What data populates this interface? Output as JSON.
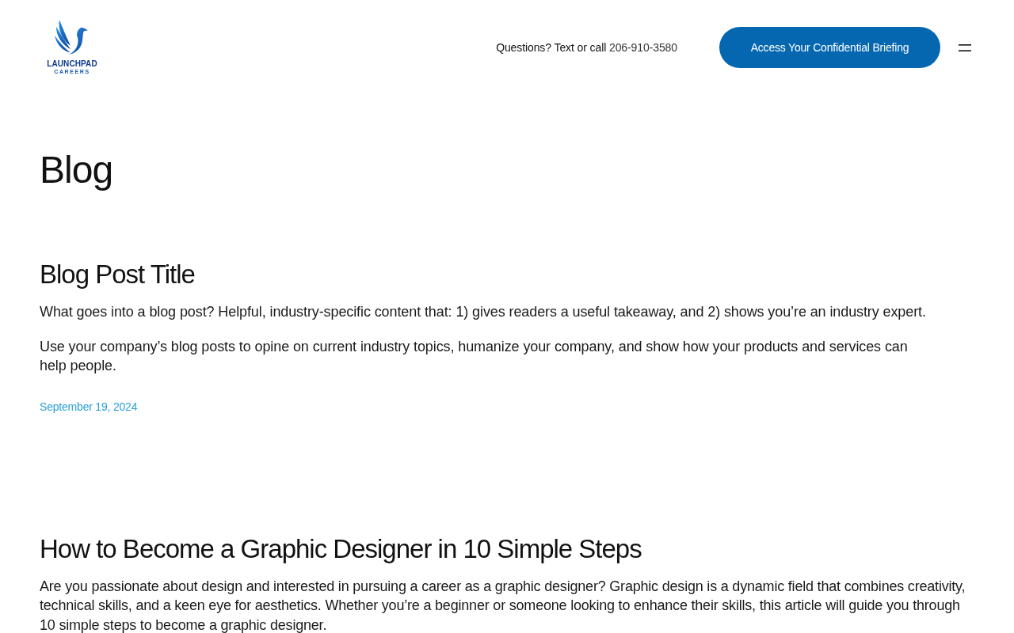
{
  "header": {
    "logo": {
      "name": "LAUNCHPAD",
      "tagline": "CAREERS"
    },
    "contact": {
      "label": "Questions? Text or call",
      "phone": "206-910-3580"
    },
    "cta_button": "Access Your Confidential Briefing"
  },
  "page_title": "Blog",
  "posts": [
    {
      "title": "Blog Post Title",
      "paragraphs": [
        "What goes into a blog post? Helpful, industry-specific content that: 1) gives readers a useful takeaway, and 2) shows you’re an industry expert.",
        "Use your company’s blog posts to opine on current industry topics, humanize your company, and show how your products and services can help people."
      ],
      "date": "September 19, 2024"
    },
    {
      "title": "How to Become a Graphic Designer in 10 Simple Steps",
      "paragraphs": [
        "Are you passionate about design and interested in pursuing a career as a graphic designer? Graphic design is a dynamic field that combines creativity, technical skills, and a keen eye for aesthetics. Whether you’re a beginner or someone looking to enhance their skills, this article will guide you through 10 simple steps to become a graphic designer."
      ]
    }
  ]
}
